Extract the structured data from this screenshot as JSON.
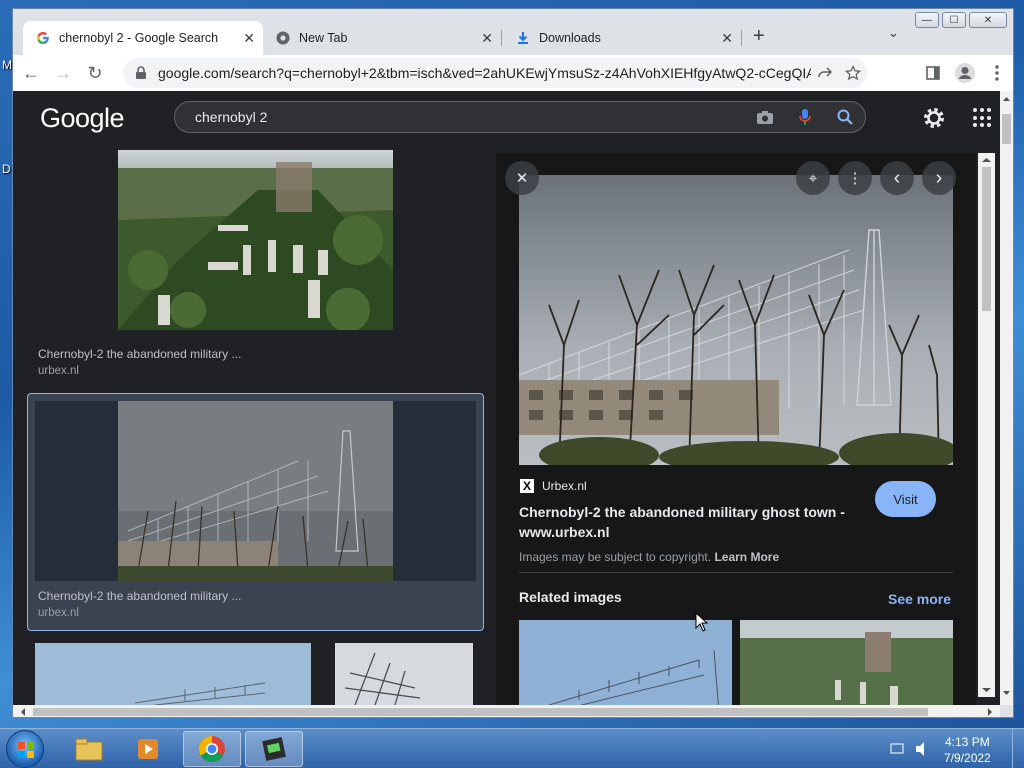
{
  "desktop": {
    "label_m": "M",
    "label_d": "D"
  },
  "window": {
    "minimize": "—",
    "maximize": "☐",
    "close": "✕"
  },
  "tabs": [
    {
      "title": "chernobyl 2 - Google Search",
      "close": "✕"
    },
    {
      "title": "New Tab",
      "close": "✕"
    },
    {
      "title": "Downloads",
      "close": "✕"
    }
  ],
  "new_tab": "+",
  "tab_search": "⌄",
  "toolbar": {
    "back": "←",
    "forward": "→",
    "reload": "↻",
    "url": "google.com/search?q=chernobyl+2&tbm=isch&ved=2ahUKEwjYmsuSz-z4AhVohXIEHfgyAtwQ2-cCegQIAB..."
  },
  "google": {
    "logo": "Google",
    "query": "chernobyl 2"
  },
  "results": [
    {
      "caption": "Chernobyl-2 the abandoned military ...",
      "source": "urbex.nl"
    },
    {
      "caption": "Chernobyl-2 the abandoned military ...",
      "source": "urbex.nl"
    }
  ],
  "preview": {
    "close": "✕",
    "lens": "⌖",
    "more": "⋮",
    "prev": "‹",
    "next": "›",
    "source": "Urbex.nl",
    "source_logo": "X",
    "title": "Chernobyl-2 the abandoned military ghost town - www.urbex.nl",
    "visit": "Visit",
    "copyright": "Images may be subject to copyright.",
    "learn_more": "Learn More",
    "related": "Related images",
    "see_more": "See more"
  },
  "taskbar": {
    "time": "4:13 PM",
    "date": "7/9/2022"
  }
}
